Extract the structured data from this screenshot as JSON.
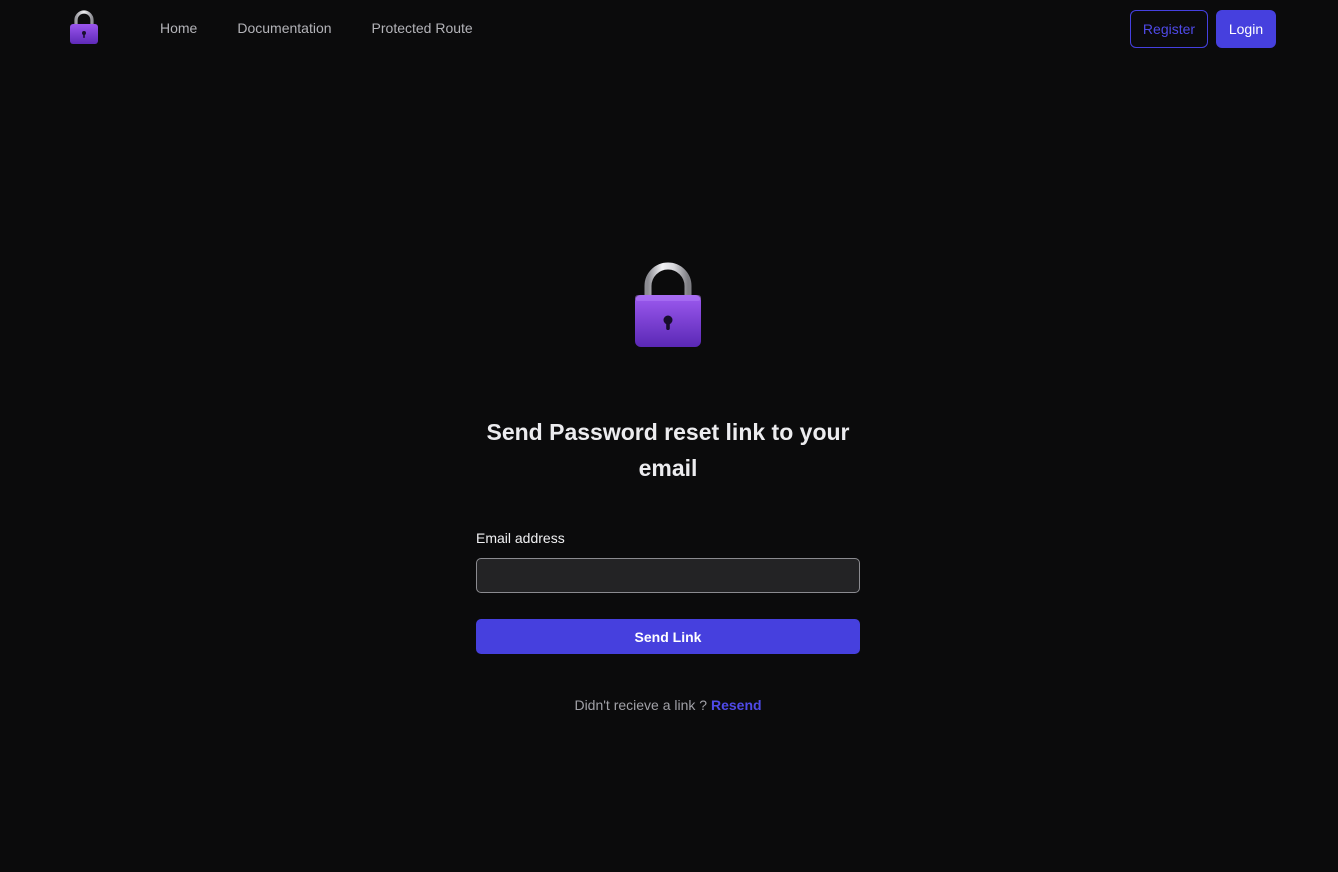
{
  "nav": {
    "logo_icon": "lock-icon",
    "links": [
      {
        "label": "Home"
      },
      {
        "label": "Documentation"
      },
      {
        "label": "Protected Route"
      }
    ],
    "register_label": "Register",
    "login_label": "Login"
  },
  "main": {
    "hero_icon": "lock-icon",
    "title": "Send Password reset link to your email",
    "email_label": "Email address",
    "email_value": "",
    "email_placeholder": "",
    "submit_label": "Send Link",
    "resend_prompt": "Didn't recieve a link ?",
    "resend_label": "Resend"
  },
  "colors": {
    "background": "#0b0b0c",
    "accent": "#4640de",
    "lock_body": "#7c3fd6",
    "shackle": "#c9c9cf"
  }
}
